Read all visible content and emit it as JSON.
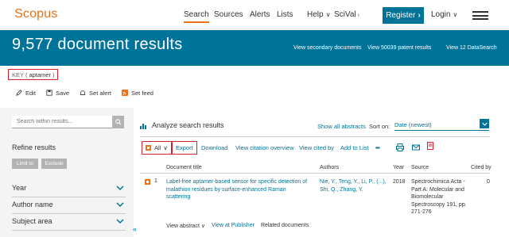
{
  "nav": {
    "logo": "Scopus",
    "items": [
      {
        "label": "Search",
        "active": true
      },
      {
        "label": "Sources"
      },
      {
        "label": "Alerts"
      },
      {
        "label": "Lists"
      },
      {
        "label": "Help"
      },
      {
        "label": "SciVal"
      }
    ],
    "help_caret": "∨",
    "scival_mark": "›",
    "register_label": "Register",
    "register_arrow": "›",
    "login_label": "Login",
    "login_caret": "∨"
  },
  "banner": {
    "title": "9,577 document results",
    "links": [
      "View secondary documents",
      "View 50039 patent results",
      "View 12 DataSearch"
    ]
  },
  "query": {
    "prefix": "KEY (",
    "term": "aptamer",
    "suffix": ")"
  },
  "actions": [
    {
      "label": "Edit",
      "icon": "pencil-icon"
    },
    {
      "label": "Save",
      "icon": "save-icon"
    },
    {
      "label": "Set alert",
      "icon": "bell-icon"
    },
    {
      "label": "Set feed",
      "icon": "rss-icon"
    }
  ],
  "sidebar": {
    "search_placeholder": "Search within results...",
    "refine_label": "Refine results",
    "limit_label": "Limit to",
    "exclude_label": "Exclude",
    "facets": [
      "Year",
      "Author name",
      "Subject area"
    ]
  },
  "results": {
    "analyze_label": "Analyze search results",
    "show_abstracts": "Show all abstracts",
    "sort_label": "Sort on:",
    "sort_value": "Date (newest)",
    "toolbar": {
      "all_label": "All",
      "all_caret": "∨",
      "export_label": "Export",
      "download_label": "Download",
      "citation_label": "View citation overview",
      "cited_label": "View cited by",
      "add_list_label": "Add to List",
      "more_label": "•••"
    },
    "columns": [
      "Document title",
      "Authors",
      "Year",
      "Source",
      "Cited by"
    ],
    "rows": [
      {
        "num": "1",
        "title": "Label-free aptamer-based sensor for specific detection of malathion residues by surface-enhanced Raman scattering",
        "authors": "Nie, Y., Teng, Y., Li, P., (...), Shi, Q., Zhang, Y.",
        "year": "2018",
        "source": "Spectrochimica Acta - Part A: Molecular and Biomolecular Spectroscopy 191, pp. 271-276",
        "cited": "0"
      }
    ],
    "row_links": {
      "abstract": "View abstract",
      "abstract_caret": "∨",
      "publisher": "View at Publisher",
      "related": "Related documents"
    }
  },
  "colors": {
    "brand_orange": "#e9711c",
    "brand_blue": "#007398",
    "highlight_red": "#d8202e"
  }
}
